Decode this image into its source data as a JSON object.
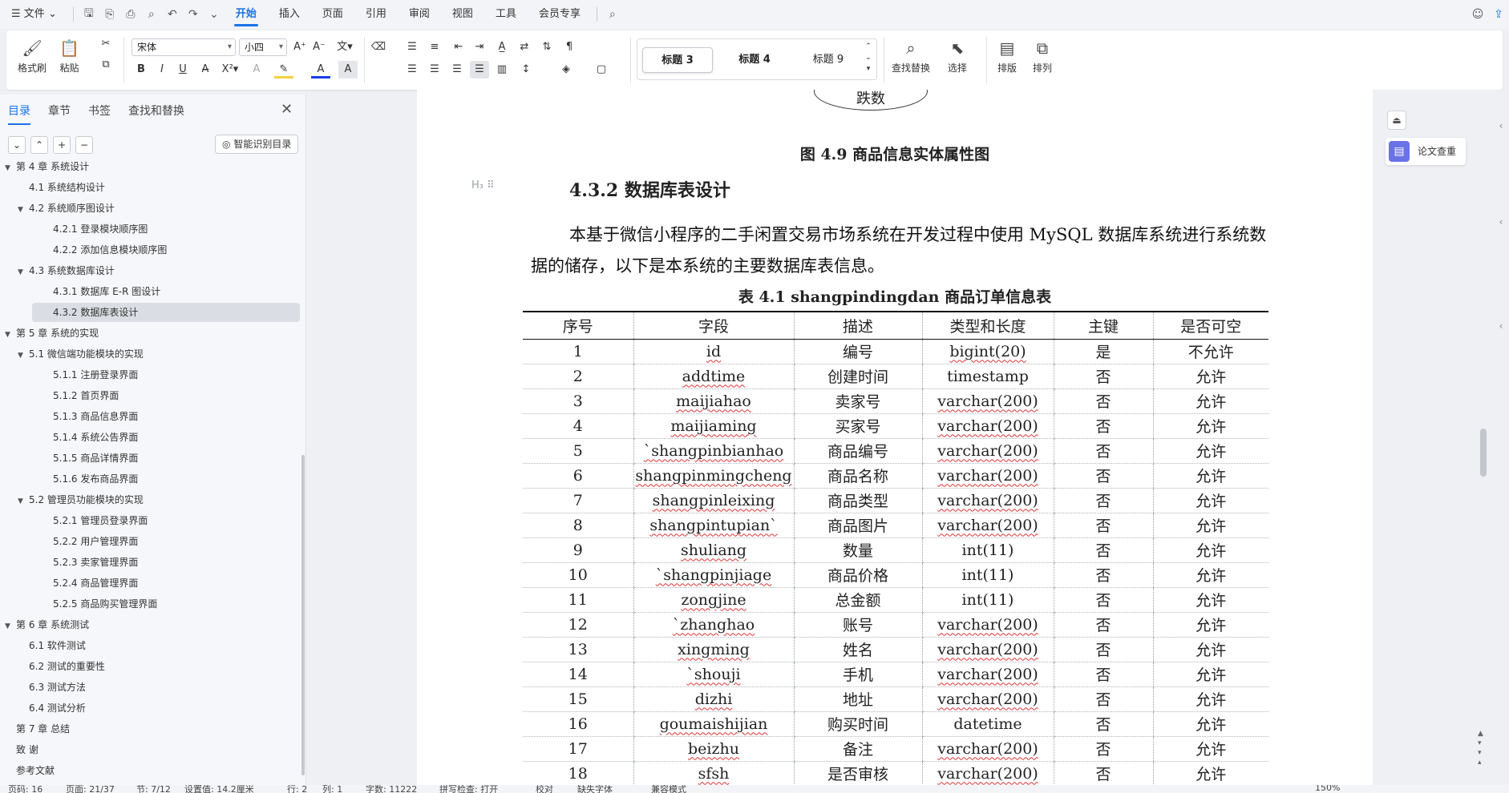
{
  "menubar": {
    "file_menu": "文件",
    "tabs": [
      "开始",
      "插入",
      "页面",
      "引用",
      "审阅",
      "视图",
      "工具",
      "会员专享"
    ],
    "active_tab": "开始"
  },
  "ribbon": {
    "format_painter": "格式刷",
    "paste": "粘贴",
    "font_name": "宋体",
    "font_size": "小四",
    "styles": [
      "标题 3",
      "标题 4",
      "标题 9"
    ],
    "find_replace": "查找替换",
    "select": "选择",
    "layout": "排版",
    "arrange": "排列"
  },
  "nav": {
    "tabs": [
      "目录",
      "章节",
      "书签",
      "查找和替换"
    ],
    "active_tab": "目录",
    "smart_toc_label": "智能识别目录",
    "items": [
      {
        "label": "第 4 章  系统设计",
        "level": 1
      },
      {
        "label": "4.1 系统结构设计",
        "level": 2
      },
      {
        "label": "4.2 系统顺序图设计",
        "level": 2
      },
      {
        "label": "4.2.1 登录模块顺序图",
        "level": 3
      },
      {
        "label": "4.2.2 添加信息模块顺序图",
        "level": 3
      },
      {
        "label": "4.3 系统数据库设计",
        "level": 2
      },
      {
        "label": "4.3.1  数据库 E-R 图设计",
        "level": 3
      },
      {
        "label": "4.3.2  数据库表设计",
        "level": 3
      },
      {
        "label": "第 5 章  系统的实现",
        "level": 1
      },
      {
        "label": "5.1 微信端功能模块的实现",
        "level": 2
      },
      {
        "label": "5.1.1 注册登录界面",
        "level": 3
      },
      {
        "label": "5.1.2 首页界面",
        "level": 3
      },
      {
        "label": "5.1.3 商品信息界面",
        "level": 3
      },
      {
        "label": "5.1.4 系统公告界面",
        "level": 3
      },
      {
        "label": "5.1.5 商品详情界面",
        "level": 3
      },
      {
        "label": "5.1.6 发布商品界面",
        "level": 3
      },
      {
        "label": "5.2 管理员功能模块的实现",
        "level": 2
      },
      {
        "label": "5.2.1 管理员登录界面",
        "level": 3
      },
      {
        "label": "5.2.2 用户管理界面",
        "level": 3
      },
      {
        "label": "5.2.3 卖家管理界面",
        "level": 3
      },
      {
        "label": "5.2.4 商品管理界面",
        "level": 3
      },
      {
        "label": "5.2.5 商品购买管理界面",
        "level": 3
      },
      {
        "label": "第 6 章  系统测试",
        "level": 1
      },
      {
        "label": "6.1  软件测试",
        "level": 2
      },
      {
        "label": "6.2  测试的重要性",
        "level": 2
      },
      {
        "label": "6.3  测试方法",
        "level": 2
      },
      {
        "label": "6.4 测试分析",
        "level": 2
      },
      {
        "label": "第 7 章  总结",
        "level": 1
      },
      {
        "label": "致    谢",
        "level": 1
      },
      {
        "label": "参考文献",
        "level": 1
      }
    ],
    "selected_index": 7
  },
  "document": {
    "ellipse_text": "跌数",
    "figure_caption": "图 4.9  商品信息实体属性图",
    "heading": "4.3.2  数据库表设计",
    "paragraph": "本基于微信小程序的二手闲置交易市场系统在开发过程中使用 MySQL 数据库系统进行系统数据的储存，以下是本系统的主要数据库表信息。",
    "table_caption": "表 4.1   shangpindingdan 商品订单信息表",
    "table": {
      "headers": [
        "序号",
        "字段",
        "描述",
        "类型和长度",
        "主键",
        "是否可空"
      ],
      "rows": [
        [
          "1",
          "id",
          "编号",
          "bigint(20)",
          "是",
          "不允许"
        ],
        [
          "2",
          "addtime",
          "创建时间",
          "timestamp",
          "否",
          "允许"
        ],
        [
          "3",
          "maijiahao",
          "卖家号",
          "varchar(200)",
          "否",
          "允许"
        ],
        [
          "4",
          "maijiaming",
          "买家号",
          "varchar(200)",
          "否",
          "允许"
        ],
        [
          "5",
          "`shangpinbianhao",
          "商品编号",
          "varchar(200)",
          "否",
          "允许"
        ],
        [
          "6",
          "shangpinmingcheng",
          "商品名称",
          "varchar(200)",
          "否",
          "允许"
        ],
        [
          "7",
          "shangpinleixing",
          "商品类型",
          "varchar(200)",
          "否",
          "允许"
        ],
        [
          "8",
          "shangpintupian`",
          "商品图片",
          "varchar(200)",
          "否",
          "允许"
        ],
        [
          "9",
          "shuliang",
          "数量",
          "int(11)",
          "否",
          "允许"
        ],
        [
          "10",
          "`shangpinjiage",
          "商品价格",
          "int(11)",
          "否",
          "允许"
        ],
        [
          "11",
          "zongjine",
          "总金额",
          "int(11)",
          "否",
          "允许"
        ],
        [
          "12",
          "`zhanghao",
          "账号",
          "varchar(200)",
          "否",
          "允许"
        ],
        [
          "13",
          "xingming",
          "姓名",
          "varchar(200)",
          "否",
          "允许"
        ],
        [
          "14",
          "`shouji",
          "手机",
          "varchar(200)",
          "否",
          "允许"
        ],
        [
          "15",
          "dizhi",
          "地址",
          "varchar(200)",
          "否",
          "允许"
        ],
        [
          "16",
          "goumaishijian",
          "购买时间",
          "datetime",
          "否",
          "允许"
        ],
        [
          "17",
          "beizhu",
          "备注",
          "varchar(200)",
          "否",
          "允许"
        ],
        [
          "18",
          "sfsh",
          "是否审核",
          "varchar(200)",
          "否",
          "允许"
        ]
      ]
    }
  },
  "right_panel": {
    "paper_check": "论文查重"
  },
  "statusbar": {
    "items": [
      "页码: 16",
      "页面: 21/37",
      "节: 7/12",
      "设置值: 14.2厘米",
      "行: 2",
      "列: 1",
      "字数: 11222",
      "拼写检查: 打开",
      "校对",
      "缺失字体",
      "兼容模式",
      "150%"
    ]
  },
  "colors": {
    "accent": "#1a73e8",
    "paper_check_icon": "#6a72e8"
  }
}
